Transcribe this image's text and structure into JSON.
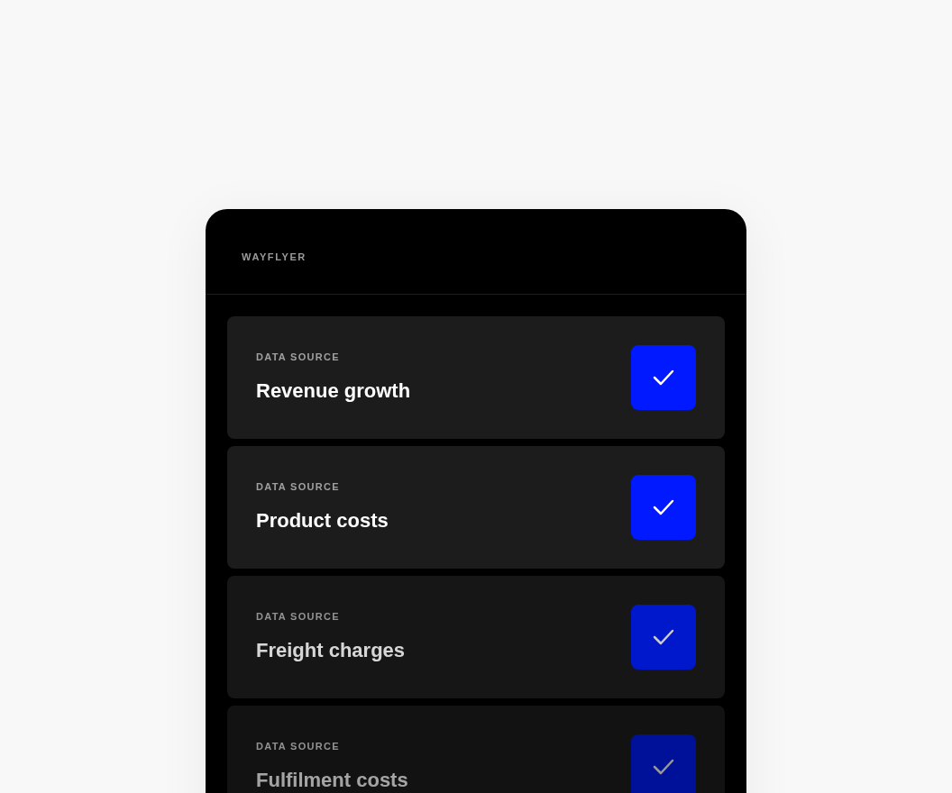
{
  "brand": "WAYFLYER",
  "sources": [
    {
      "label": "DATA SOURCE",
      "title": "Revenue growth",
      "checked": true
    },
    {
      "label": "DATA SOURCE",
      "title": "Product costs",
      "checked": true
    },
    {
      "label": "DATA SOURCE",
      "title": "Freight charges",
      "checked": true
    },
    {
      "label": "DATA SOURCE",
      "title": "Fulfilment costs",
      "checked": true
    }
  ]
}
